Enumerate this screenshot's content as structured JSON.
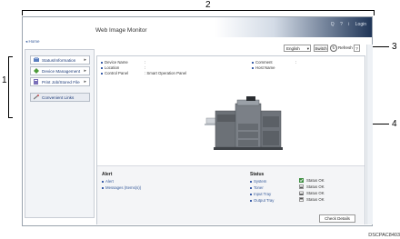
{
  "callouts": {
    "n1": "1",
    "n2": "2",
    "n3": "3",
    "n4": "4"
  },
  "header": {
    "title": "Web Image Monitor",
    "home_link": "Home",
    "icons": [
      "Q",
      "?",
      "i",
      "Login"
    ]
  },
  "sidebar": {
    "items": [
      {
        "label": "Status/Information",
        "icon": "status-icon"
      },
      {
        "label": "Device Management",
        "icon": "device-management-icon"
      },
      {
        "label": "Print Job/Stored File",
        "icon": "print-job-icon"
      },
      {
        "label": "Convenient Links",
        "icon": "link-icon"
      }
    ]
  },
  "toolbar": {
    "language": "English",
    "switch_label": "Switch",
    "refresh_label": "Refresh",
    "help_label": "?"
  },
  "device_info": {
    "device_name_label": "Device Name",
    "device_name_value": ":",
    "location_label": "Location",
    "location_value": ":",
    "control_panel_label": "Control Panel",
    "control_panel_value": ": Smart Operation Panel",
    "comment_label": "Comment",
    "comment_value": ":",
    "host_name_label": "Host Name"
  },
  "alert": {
    "title": "Alert",
    "items": [
      "Alert",
      "Messages (Items(s))"
    ]
  },
  "status": {
    "title": "Status",
    "items": [
      {
        "label": "System",
        "value": "Status OK"
      },
      {
        "label": "Toner",
        "value": "Status OK"
      },
      {
        "label": "Input Tray",
        "value": "Status OK"
      },
      {
        "label": "Output Tray",
        "value": "Status OK"
      }
    ],
    "check_details_label": "Check Details"
  },
  "figure_code": "DSCPAC8403",
  "colors": {
    "accent": "#1f3557",
    "link": "#355a9a"
  }
}
